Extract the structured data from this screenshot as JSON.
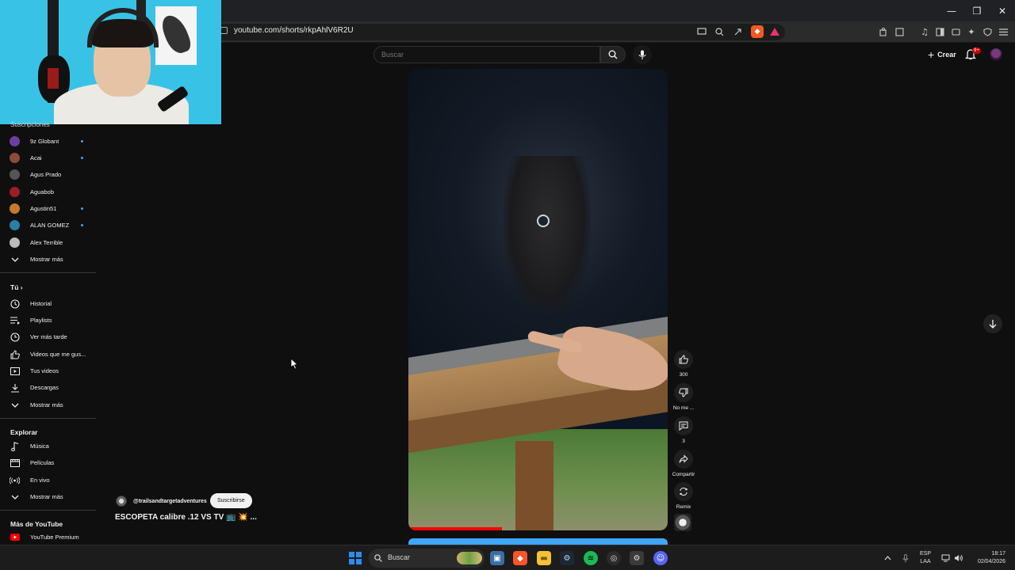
{
  "browser": {
    "url": "youtube.com/shorts/rkpAhlV6R2U",
    "window_controls": [
      "—",
      "❐",
      "✕"
    ]
  },
  "header": {
    "search_placeholder": "Buscar",
    "create_label": "Crear",
    "notifications_badge": "9+"
  },
  "sidebar": {
    "subscriptions_title": "Suscripciones",
    "channels": [
      {
        "label": "9z Globant",
        "color": "#6b3fa0",
        "new": true
      },
      {
        "label": "Acai",
        "color": "#8b4a3a",
        "new": true
      },
      {
        "label": "Agus Prado",
        "color": "#555555",
        "new": false
      },
      {
        "label": "Aguabob",
        "color": "#9a1d2a",
        "new": false
      },
      {
        "label": "Agustin51",
        "color": "#c77b2a",
        "new": true
      },
      {
        "label": "ALAN GOMEZ",
        "color": "#2a7fa6",
        "new": true
      },
      {
        "label": "Alex Terrible",
        "color": "#bbbbbb",
        "new": false
      }
    ],
    "show_more_1": "Mostrar más",
    "you_title": "Tú",
    "you_items": [
      {
        "label": "Historial",
        "icon": "history-icon"
      },
      {
        "label": "Playlists",
        "icon": "playlists-icon"
      },
      {
        "label": "Ver más tarde",
        "icon": "watch-later-icon"
      },
      {
        "label": "Videos que me gus...",
        "icon": "liked-videos-icon"
      },
      {
        "label": "Tus videos",
        "icon": "your-videos-icon"
      },
      {
        "label": "Descargas",
        "icon": "downloads-icon"
      }
    ],
    "show_more_2": "Mostrar más",
    "explore_title": "Explorar",
    "explore_items": [
      {
        "label": "Música",
        "icon": "music-icon"
      },
      {
        "label": "Películas",
        "icon": "movies-icon"
      },
      {
        "label": "En vivo",
        "icon": "live-icon"
      }
    ],
    "show_more_3": "Mostrar más",
    "more_title": "Más de YouTube",
    "premium_label": "YouTube Premium"
  },
  "short": {
    "channel": "@trailsandtargetadventures",
    "subscribe_label": "Suscribirse",
    "title": "ESCOPETA calibre .12 VS TV 📺 💥 ...",
    "likes": "300",
    "dislike_label": "No me ...",
    "comments": "3",
    "share_label": "Compartir",
    "remix_label": "Remix",
    "progress": 0.36
  },
  "taskbar": {
    "search_label": "Buscar",
    "lang_line1": "ESP",
    "lang_line2": "LAA",
    "time": "18:17",
    "date": "02/04/2026"
  }
}
